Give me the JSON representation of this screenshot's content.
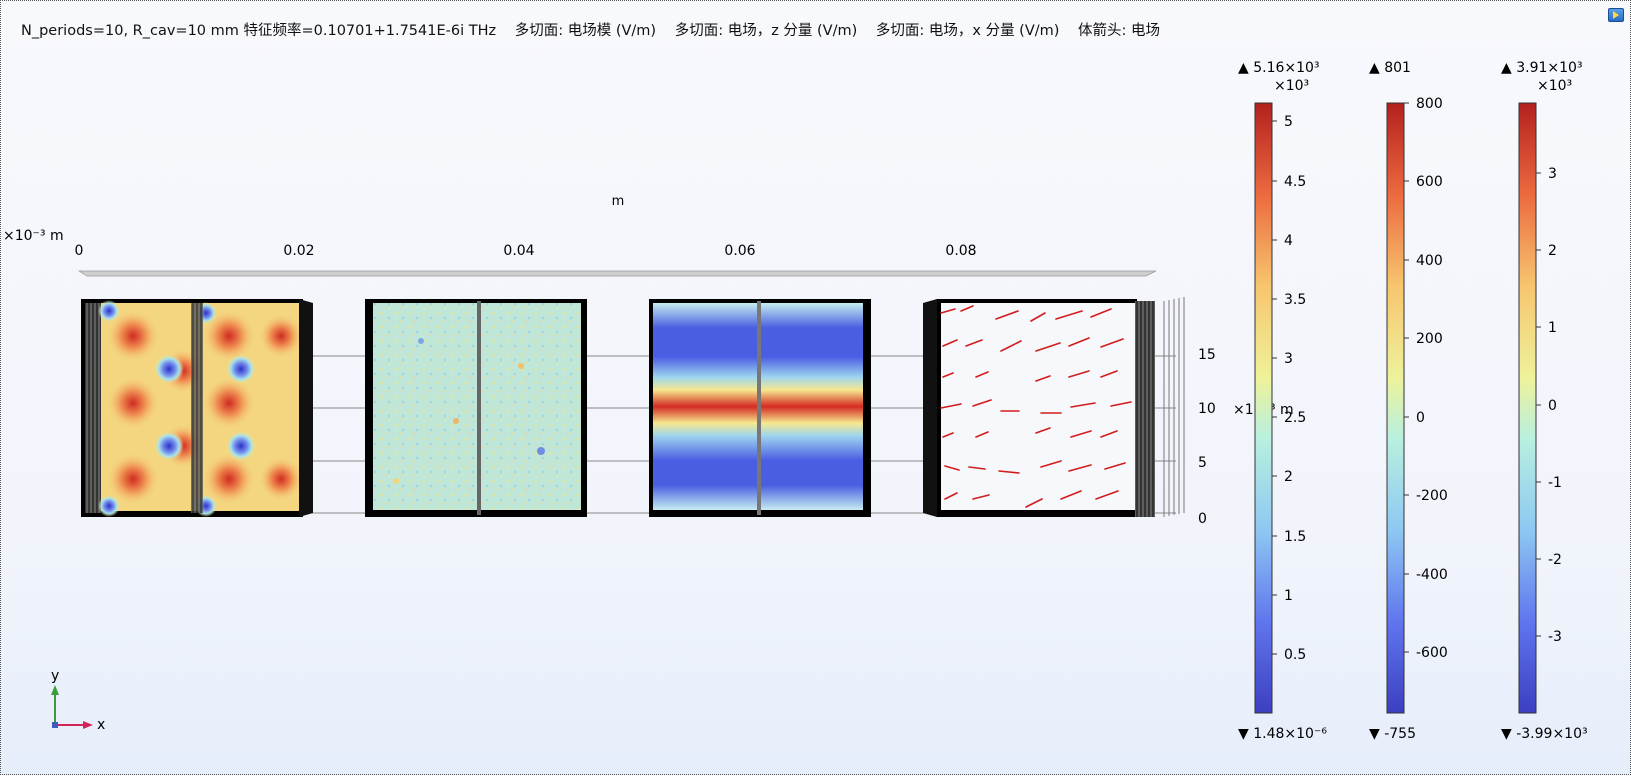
{
  "title": {
    "params": "N_periods=10, R_cav=10 mm 特征频率=0.10701+1.7541E-6i THz",
    "plot1": "多切面: 电场模 (V/m)",
    "plot2": "多切面: 电场，z 分量 (V/m)",
    "plot3": "多切面: 电场，x 分量 (V/m)",
    "plot4": "体箭头: 电场"
  },
  "axes": {
    "x_unit_label": "m",
    "x_multiplier_label": "×10⁻³ m",
    "x_ticks": [
      "0",
      "0.02",
      "0.04",
      "0.06",
      "0.08"
    ],
    "y_ticks": [
      "15",
      "10",
      "5",
      "0"
    ],
    "y_multiplier_label": "×10⁻³ m"
  },
  "colorbars": [
    {
      "max_label": "▲ 5.16×10³",
      "exponent_label": "×10³",
      "ticks": [
        "5",
        "4.5",
        "4",
        "3.5",
        "3",
        "2.5",
        "2",
        "1.5",
        "1",
        "0.5"
      ],
      "min_label": "▼ 1.48×10⁻⁶"
    },
    {
      "max_label": "▲ 801",
      "exponent_label": "",
      "ticks": [
        "800",
        "600",
        "400",
        "200",
        "0",
        "-200",
        "-400",
        "-600"
      ],
      "min_label": "▼ -755"
    },
    {
      "max_label": "▲ 3.91×10³",
      "exponent_label": "×10³",
      "ticks": [
        "3",
        "2",
        "1",
        "0",
        "-1",
        "-2",
        "-3"
      ],
      "min_label": "▼ -3.99×10³"
    }
  ],
  "triad": {
    "y_label": "y",
    "x_label": "x"
  }
}
